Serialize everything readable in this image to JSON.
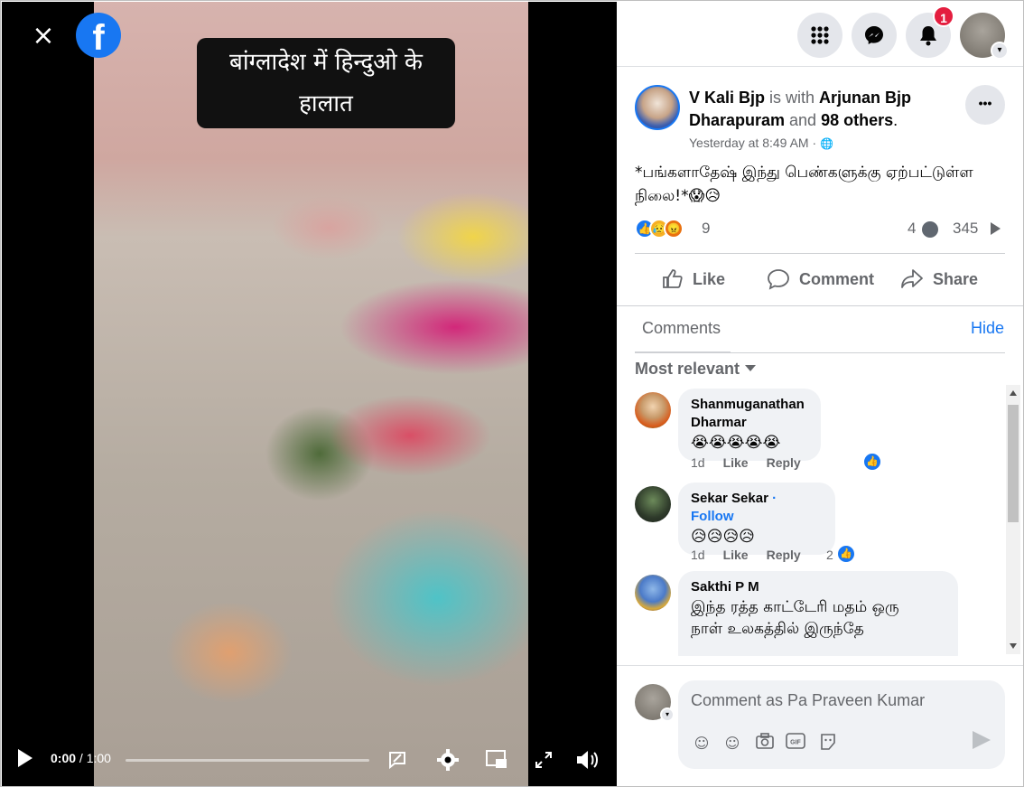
{
  "video": {
    "close_icon": "×",
    "fb_logo": "f",
    "caption": "बांग्लादेश में हिन्दुओ के हालात",
    "time_current": "0:00",
    "time_total": " / 1:00",
    "progress": 0
  },
  "topbar": {
    "notifications_badge": "1"
  },
  "post": {
    "author": "V Kali Bjp",
    "with_text": " is with ",
    "tagged": "Arjunan Bjp Dharapuram",
    "and_text": " and ",
    "others": "98 others",
    "period": ".",
    "time": "Yesterday at 8:49 AM · ",
    "globe": "🌐",
    "dots": "•••",
    "text": "*பங்களாதேஷ் இந்து பெண்களுக்கு ஏற்பட்டுள்ள நிலை!*😱😥",
    "reaction_count": "9",
    "comments_count": "4",
    "views_count": "345",
    "actions": {
      "like": "Like",
      "comment": "Comment",
      "share": "Share"
    }
  },
  "comments": {
    "tab": "Comments",
    "hide": "Hide",
    "sort": "Most relevant",
    "items": [
      {
        "name": "Shanmuganathan Dharmar",
        "text": "😭😭😭😭😭",
        "age": "1d",
        "like": "Like",
        "reply": "Reply",
        "likes": ""
      },
      {
        "name": "Sekar Sekar",
        "follow": " · Follow",
        "text": "😥😥😥😥",
        "age": "1d",
        "like": "Like",
        "reply": "Reply",
        "likes": "2"
      },
      {
        "name": "Sakthi P M",
        "text": "இந்த ரத்த காட்டேரி மதம் ஒரு நாள் உலகத்தில் இருந்தே"
      }
    ]
  },
  "composer": {
    "placeholder": "Comment as Pa Praveen Kumar"
  },
  "colors": {
    "accent": "#1877f2",
    "badge": "#e41e3f"
  }
}
